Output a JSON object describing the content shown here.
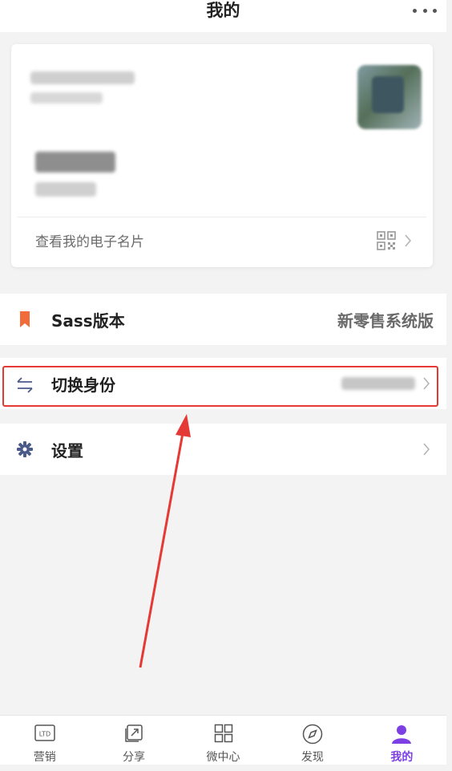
{
  "header": {
    "title": "我的"
  },
  "profile_card": {
    "link_label": "查看我的电子名片"
  },
  "menu": [
    {
      "label": "Sass版本",
      "value": "新零售系统版",
      "icon": "bookmark-icon",
      "icon_color": "#f26b3a"
    },
    {
      "label": "切换身份",
      "value": "",
      "icon": "switch-arrows-icon",
      "icon_color": "#4a5a8a"
    },
    {
      "label": "设置",
      "value": "",
      "icon": "gear-icon",
      "icon_color": "#4a5a8a"
    }
  ],
  "annotation": {
    "color": "#e53935"
  },
  "tabbar": {
    "active_color": "#7b3fe4",
    "tabs": [
      {
        "label": "营销",
        "icon": "ltd-icon",
        "icon_text": "LTD"
      },
      {
        "label": "分享",
        "icon": "share-icon"
      },
      {
        "label": "微中心",
        "icon": "grid-icon"
      },
      {
        "label": "发现",
        "icon": "compass-icon"
      },
      {
        "label": "我的",
        "icon": "person-icon",
        "active": true
      }
    ]
  }
}
